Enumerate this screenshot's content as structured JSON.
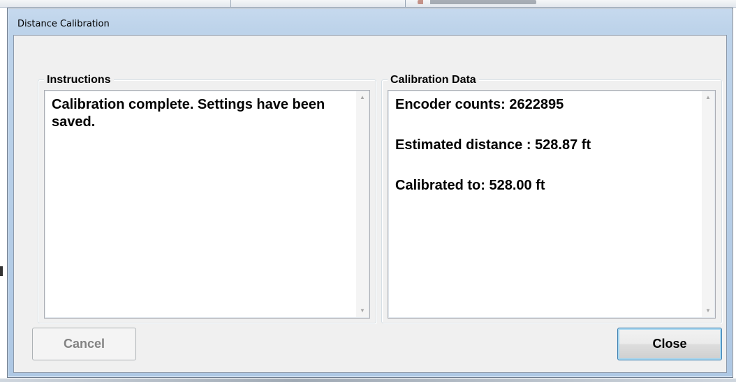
{
  "window": {
    "title": "Distance Calibration"
  },
  "instructions": {
    "label": "Instructions",
    "text": "Calibration complete. Settings have been saved."
  },
  "calibration_data": {
    "label": "Calibration Data",
    "lines": [
      "Encoder counts: 2622895",
      "Estimated distance : 528.87 ft",
      "Calibrated to: 528.00 ft"
    ]
  },
  "buttons": {
    "cancel": "Cancel",
    "close": "Close"
  },
  "icons": {
    "scroll_up": "scroll-up-arrow-icon",
    "scroll_down": "scroll-down-arrow-icon"
  }
}
